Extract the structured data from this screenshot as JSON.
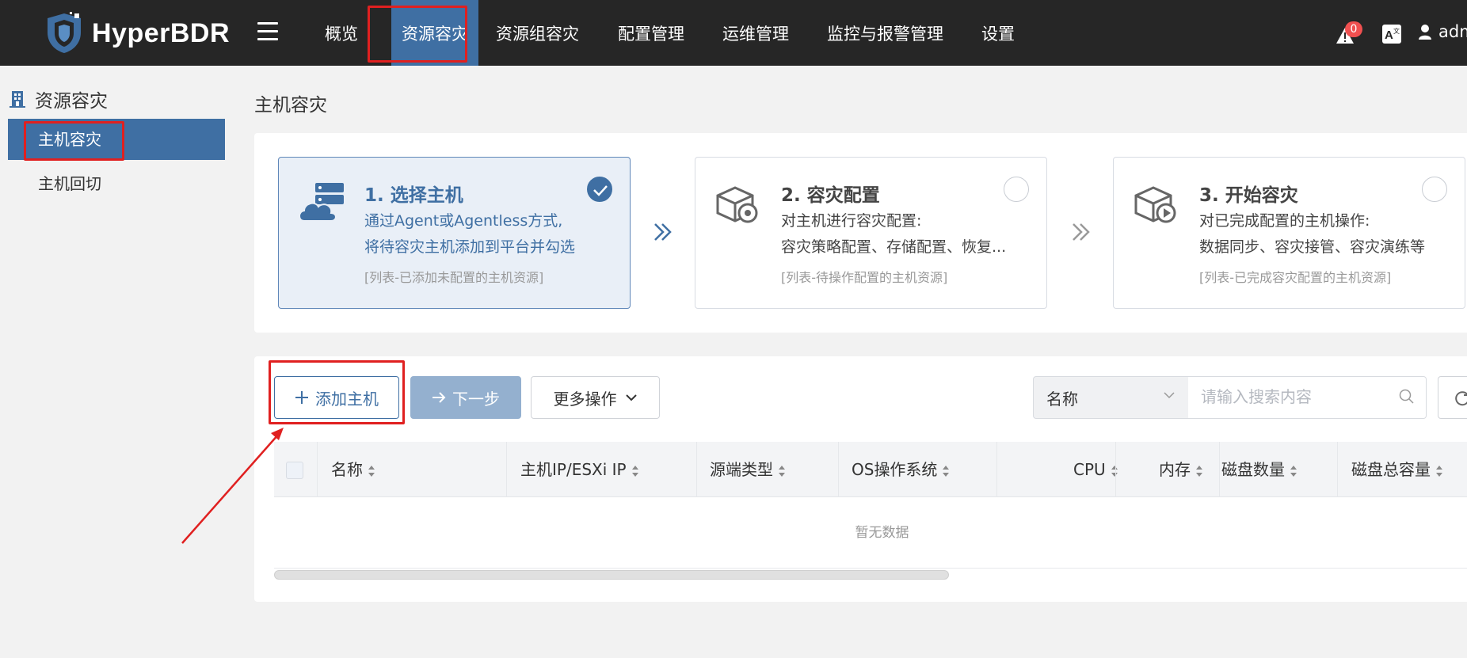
{
  "brand": {
    "name": "HyperBDR"
  },
  "nav": {
    "items": [
      {
        "label": "概览"
      },
      {
        "label": "资源容灾"
      },
      {
        "label": "资源组容灾"
      },
      {
        "label": "配置管理"
      },
      {
        "label": "运维管理"
      },
      {
        "label": "监控与报警管理"
      },
      {
        "label": "设置"
      }
    ],
    "active": "资源容灾"
  },
  "topbar": {
    "alert_count": "0",
    "user": "adm"
  },
  "sidebar": {
    "title": "资源容灾",
    "items": [
      {
        "label": "主机容灾"
      },
      {
        "label": "主机回切"
      }
    ]
  },
  "page": {
    "title": "主机容灾"
  },
  "steps": [
    {
      "title": "1. 选择主机",
      "desc_line1": "通过Agent或Agentless方式,",
      "desc_line2": "将待容灾主机添加到平台并勾选",
      "note": "[列表-已添加未配置的主机资源]",
      "done": true
    },
    {
      "title": "2. 容灾配置",
      "desc_line1": "对主机进行容灾配置:",
      "desc_line2": "容灾策略配置、存储配置、恢复...",
      "note": "[列表-待操作配置的主机资源]",
      "done": false
    },
    {
      "title": "3. 开始容灾",
      "desc_line1": "对已完成配置的主机操作:",
      "desc_line2": "数据同步、容灾接管、容灾演练等",
      "note": "[列表-已完成容灾配置的主机资源]",
      "done": false
    }
  ],
  "toolbar": {
    "add_label": "添加主机",
    "next_label": "下一步",
    "more_label": "更多操作",
    "search_field": "名称",
    "search_placeholder": "请输入搜索内容"
  },
  "table": {
    "columns": [
      "名称",
      "主机IP/ESXi IP",
      "源端类型",
      "OS操作系统",
      "CPU",
      "内存",
      "磁盘数量",
      "磁盘总容量"
    ],
    "empty_text": "暂无数据"
  },
  "colors": {
    "topbar_bg": "#262626",
    "accent": "#3f6fa3",
    "annotation_red": "#e02020"
  }
}
